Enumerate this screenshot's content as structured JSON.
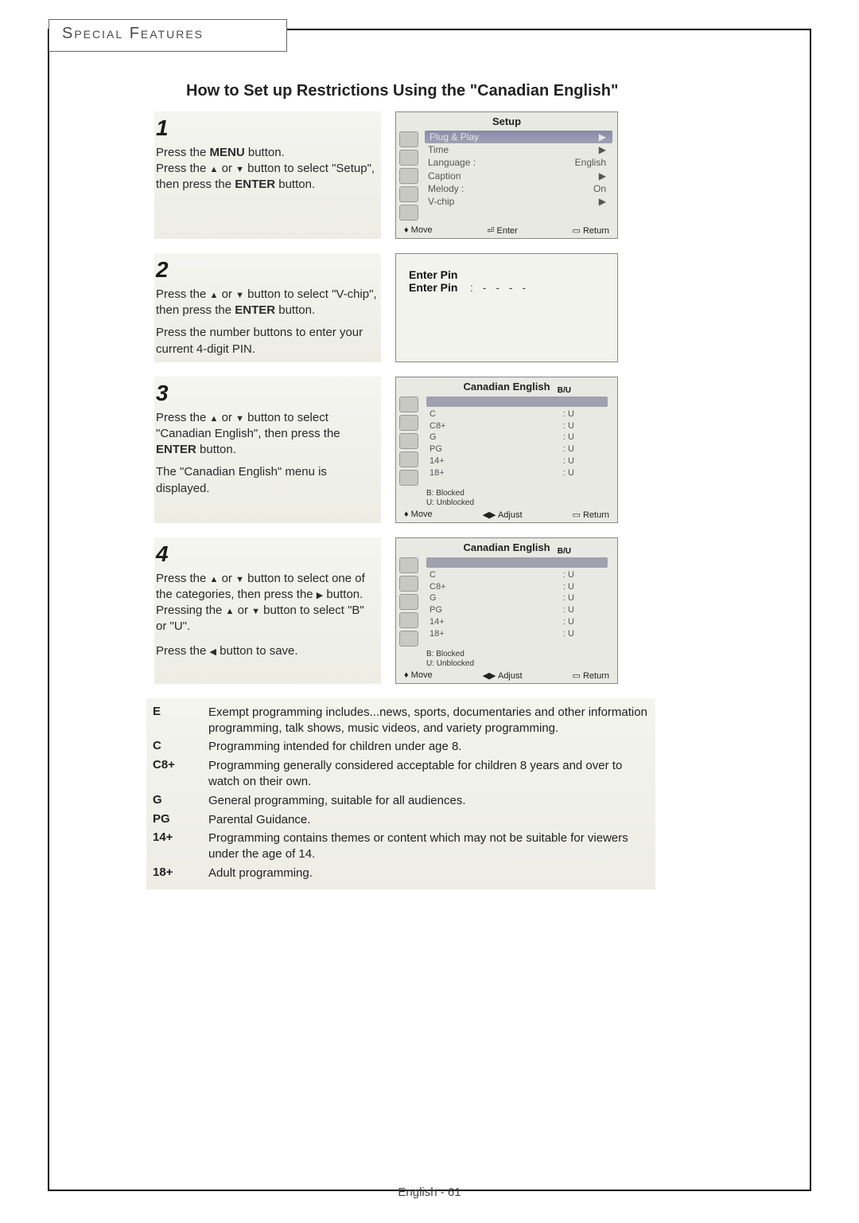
{
  "tab_title": "Special Features",
  "page_title": "How to Set up Restrictions Using the \"Canadian English\"",
  "page_footer": "English - 61",
  "steps": {
    "s1": {
      "num": "1",
      "p1a": "Press the ",
      "p1b": "MENU",
      "p1c": " button.",
      "p2a": "Press the ",
      "p2b": " or ",
      "p2c": " button to select \"Setup\", then press the ",
      "p2d": "ENTER",
      "p2e": " button."
    },
    "s2": {
      "num": "2",
      "p1a": "Press the ",
      "p1b": " or ",
      "p1c": " button to select \"V-chip\", then press the ",
      "p1d": "ENTER",
      "p1e": " button.",
      "p2": "Press the number buttons to enter your current 4-digit PIN."
    },
    "s3": {
      "num": "3",
      "p1a": "Press the ",
      "p1b": " or ",
      "p1c": " button to select \"Canadian English\", then press the ",
      "p1d": "ENTER",
      "p1e": " button.",
      "p2": "The \"Canadian English\" menu is displayed."
    },
    "s4": {
      "num": "4",
      "p1a": "Press the ",
      "p1b": " or ",
      "p1c": " button to select one of the categories, then press the ",
      "p1d": " button. Pressing the ",
      "p1e": " or ",
      "p1f": " button to select \"B\" or \"U\".",
      "p2a": "Press the ",
      "p2b": " button to save."
    }
  },
  "osd_setup": {
    "title": "Setup",
    "rows": [
      {
        "l": "Plug & Play",
        "r": "▶",
        "hl": true
      },
      {
        "l": "Time",
        "r": "▶"
      },
      {
        "l": "Language :",
        "r": "English"
      },
      {
        "l": "Caption",
        "r": "▶"
      },
      {
        "l": "Melody :",
        "r": "On"
      },
      {
        "l": "V-chip",
        "r": "▶"
      }
    ],
    "footer": {
      "a": "Move",
      "b": "Enter",
      "c": "Return"
    }
  },
  "osd_pin": {
    "l1": "Enter Pin",
    "l2": "Enter Pin",
    "dots": ": - - - -"
  },
  "osd_ce": {
    "title": "Canadian English",
    "bu": "B/U",
    "ratings": [
      "C",
      "C8+",
      "G",
      "PG",
      "14+",
      "18+"
    ],
    "vals": [
      "U",
      "U",
      "U",
      "U",
      "U",
      "U"
    ],
    "legend_b": "B:  Blocked",
    "legend_u": "U:  Unblocked",
    "footer": {
      "a": "Move",
      "b": "Adjust",
      "c": "Return"
    }
  },
  "defs": [
    {
      "lbl": "E",
      "txt": "Exempt programming includes...news, sports, documentaries and other information programming, talk shows, music videos, and variety programming."
    },
    {
      "lbl": "C",
      "txt": "Programming intended for children under age 8."
    },
    {
      "lbl": "C8+",
      "txt": "Programming generally considered acceptable for children 8 years and over to watch on their own."
    },
    {
      "lbl": "G",
      "txt": "General programming, suitable for all audiences."
    },
    {
      "lbl": "PG",
      "txt": "Parental Guidance."
    },
    {
      "lbl": "14+",
      "txt": "Programming contains themes or content which may not be suitable for viewers under the age of 14."
    },
    {
      "lbl": "18+",
      "txt": "Adult programming."
    }
  ]
}
